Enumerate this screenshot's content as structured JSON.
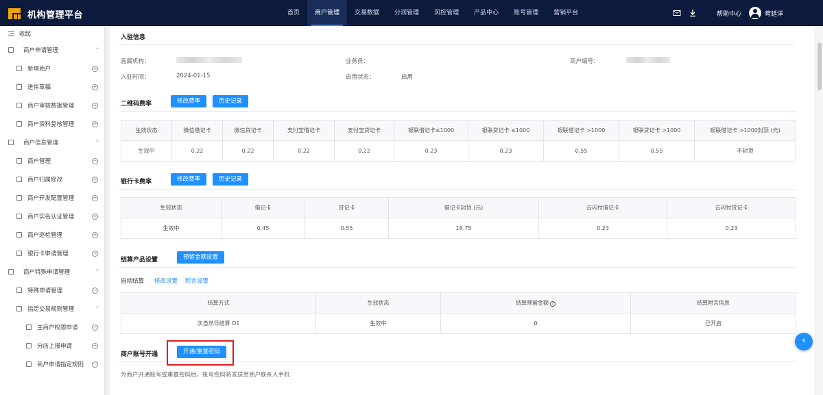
{
  "app": {
    "title": "机构管理平台"
  },
  "topnav": {
    "items": [
      "首页",
      "商户管理",
      "交易数据",
      "分润管理",
      "风控管理",
      "产品中心",
      "账号管理",
      "营销平台"
    ],
    "active_index": 1,
    "help": "帮助中心",
    "username": "苟廷洋"
  },
  "sidebar": {
    "collapse": "收起",
    "items": [
      {
        "label": "商户申请管理",
        "level": 0,
        "ctl": "^"
      },
      {
        "label": "新增商户",
        "level": 1,
        "ctl": "+"
      },
      {
        "label": "进件草稿",
        "level": 1,
        "ctl": "+"
      },
      {
        "label": "商户审核数据管理",
        "level": 1,
        "ctl": "+"
      },
      {
        "label": "商户资料复核管理",
        "level": 1,
        "ctl": "+"
      },
      {
        "label": "商户信息管理",
        "level": 0,
        "ctl": "^"
      },
      {
        "label": "商户管理",
        "level": 1,
        "ctl": "-"
      },
      {
        "label": "商户归属修改",
        "level": 1,
        "ctl": "+"
      },
      {
        "label": "商户开发配置管理",
        "level": 1,
        "ctl": "+"
      },
      {
        "label": "商户实名认证管理",
        "level": 1,
        "ctl": "+"
      },
      {
        "label": "商户巡检管理",
        "level": 1,
        "ctl": "+"
      },
      {
        "label": "银行卡申请管理",
        "level": 1,
        "ctl": "+"
      },
      {
        "label": "商户特殊申请管理",
        "level": 0,
        "ctl": "^"
      },
      {
        "label": "特殊申请管理",
        "level": 1,
        "ctl": "-"
      },
      {
        "label": "指定交易规则管理",
        "level": 1,
        "ctl": "^"
      },
      {
        "label": "主商户权限申请",
        "level": 2,
        "ctl": "-"
      },
      {
        "label": "分店上报申请",
        "level": 2,
        "ctl": "+"
      },
      {
        "label": "商户申请指定规则",
        "level": 2,
        "ctl": "-"
      }
    ]
  },
  "entry": {
    "title": "入驻信息",
    "org_label": "直属机构：",
    "salesman_label": "业务员：",
    "merchant_no_label": "商户编号：",
    "join_time_label": "入驻时间：",
    "join_time": "2024-01-15",
    "status_label": "启用状态：",
    "status": "启用"
  },
  "qr_rate": {
    "title": "二维码费率",
    "modify_btn": "修改费率",
    "history_btn": "历史记录",
    "headers": [
      "生效状态",
      "微信借记卡",
      "微信贷记卡",
      "支付宝借记卡",
      "支付宝贷记卡",
      "银联借记卡≤1000",
      "银联贷记卡 ≤1000",
      "银联借记卡 >1000",
      "银联贷记卡 >1000",
      "银联借记卡 >1000封顶 (元)"
    ],
    "row": [
      "生效中",
      "0.22",
      "0.22",
      "0.22",
      "0.22",
      "0.23",
      "0.23",
      "0.55",
      "0.55",
      "不封顶"
    ]
  },
  "bank_rate": {
    "title": "银行卡费率",
    "modify_btn": "修改费率",
    "history_btn": "历史记录",
    "headers": [
      "生效状态",
      "借记卡",
      "贷记卡",
      "借记卡封顶 (元)",
      "云闪付借记卡",
      "云闪付贷记卡"
    ],
    "row": [
      "生效中",
      "0.45",
      "0.55",
      "18.75",
      "0.23",
      "0.23"
    ]
  },
  "settle": {
    "title": "结算产品设置",
    "reserve_btn": "预留金额设置",
    "auto_label": "自动结算",
    "modify_link": "修改设置",
    "attach_link": "附言设置",
    "headers": [
      "结算方式",
      "生效状态",
      "结算预留金额",
      "结算附言信息"
    ],
    "row": [
      "次自然日结算 D1",
      "生效中",
      "0",
      "已开启"
    ]
  },
  "account": {
    "title": "商户账号开通",
    "open_btn": "开通/重置密码",
    "note": "为商户开通账号或重置密码后，账号密码将发送至商户联系人手机"
  },
  "float_btn": "‹"
}
